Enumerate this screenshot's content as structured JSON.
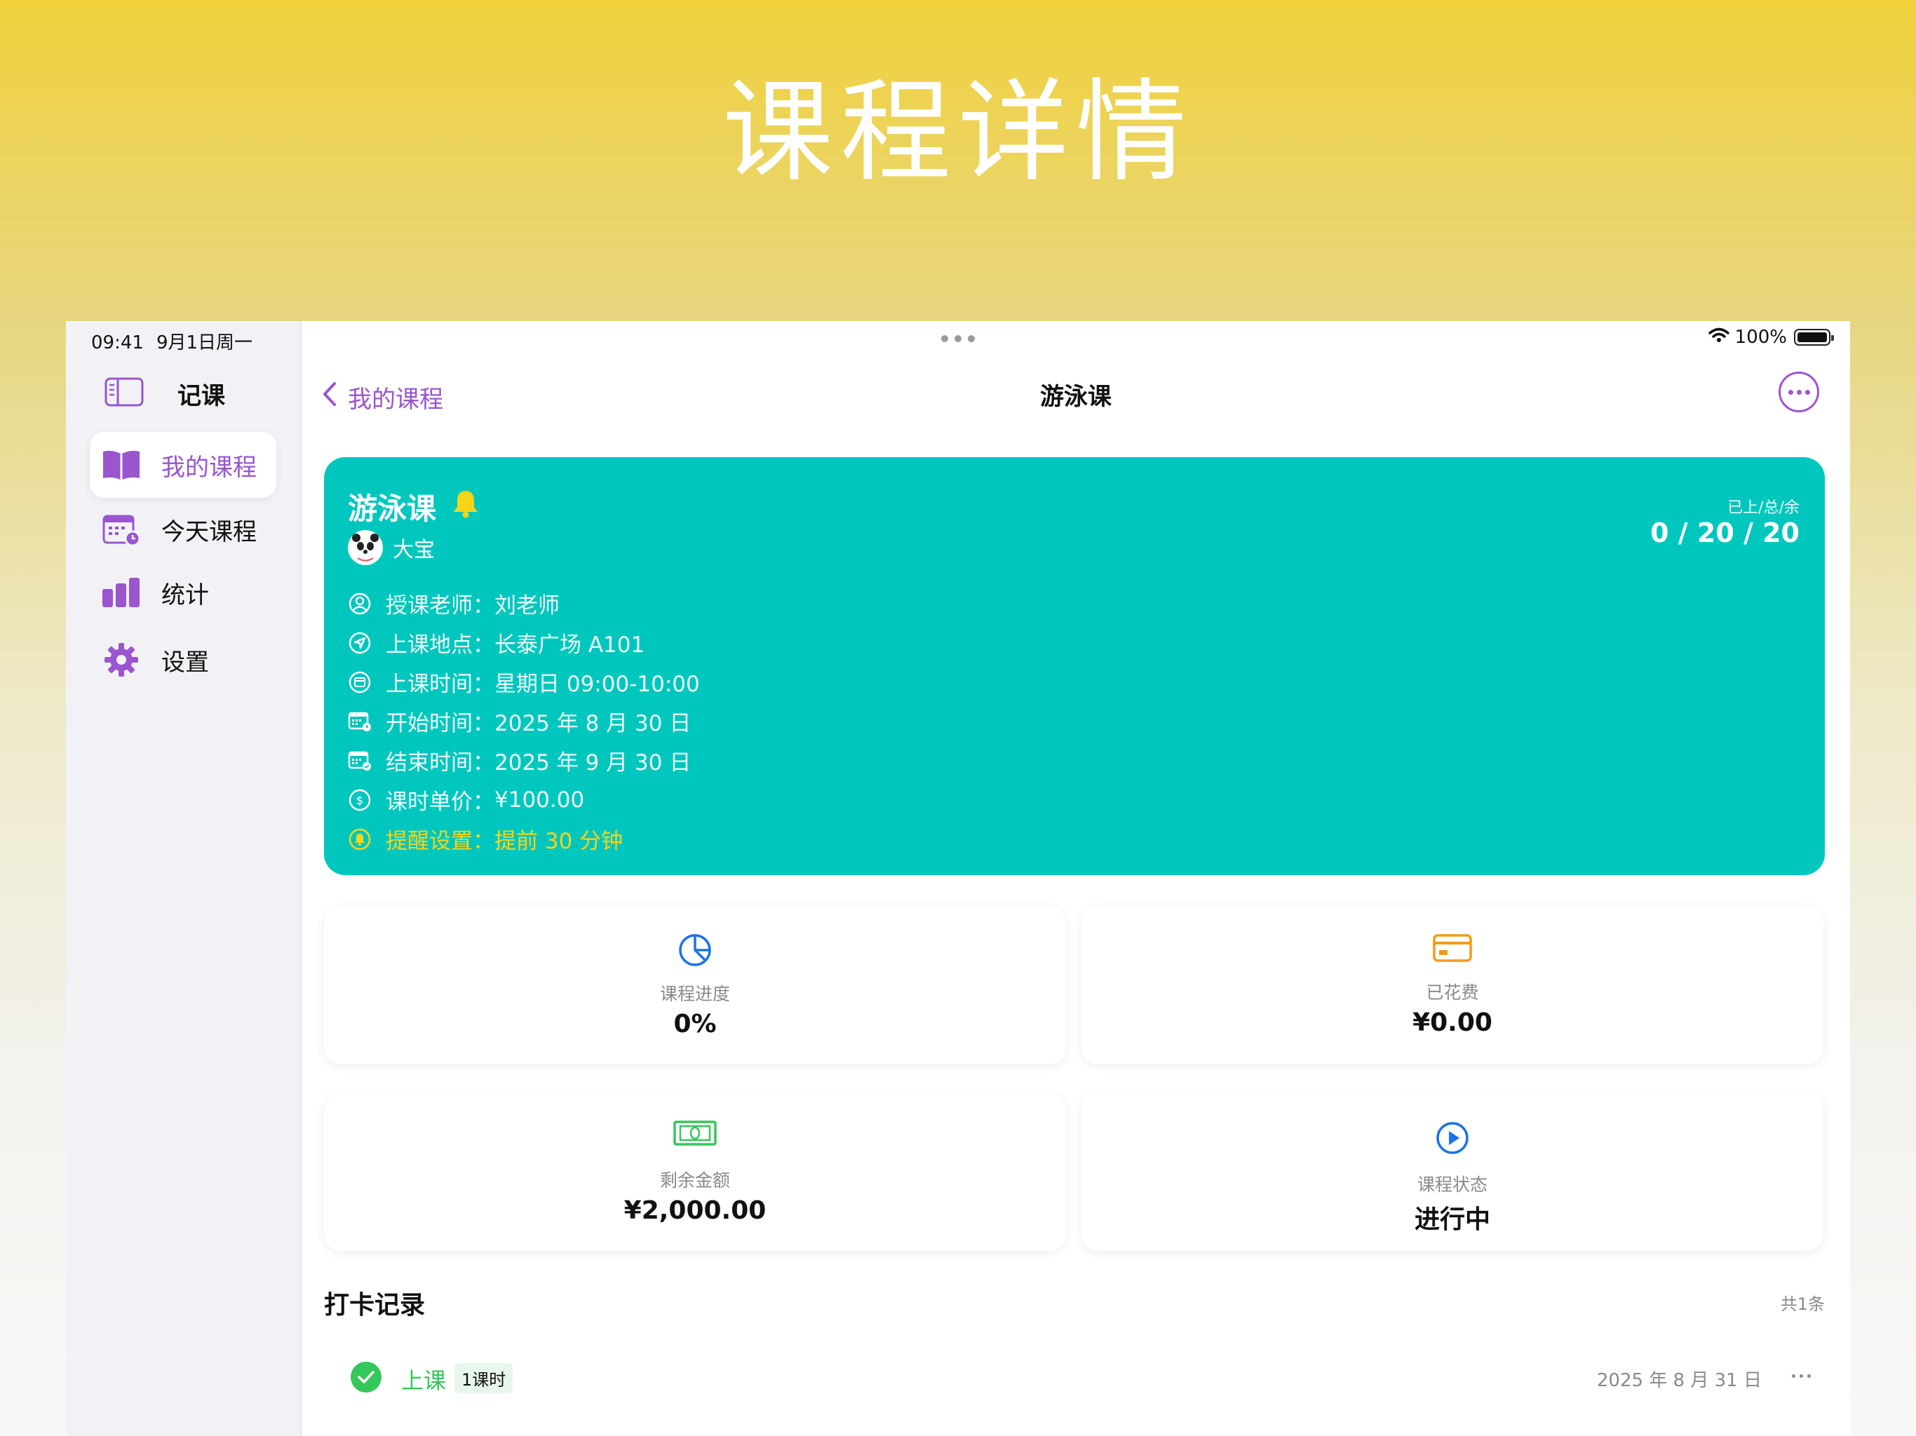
{
  "hero_title": "课程详情",
  "status": {
    "time": "09:41",
    "date": "9月1日周一",
    "battery": "100%"
  },
  "sidebar": {
    "app_name": "记课",
    "items": [
      {
        "label": "我的课程",
        "icon": "book-icon",
        "active": true
      },
      {
        "label": "今天课程",
        "icon": "calendar-clock-icon",
        "active": false
      },
      {
        "label": "统计",
        "icon": "bar-chart-icon",
        "active": false
      },
      {
        "label": "设置",
        "icon": "gear-icon",
        "active": false
      }
    ]
  },
  "nav": {
    "back_label": "我的课程",
    "title": "游泳课"
  },
  "course": {
    "name": "游泳课",
    "student": "大宝",
    "count_label": "已上/总/余",
    "count_value": "0 / 20 / 20",
    "rows": [
      {
        "label": "授课老师：",
        "value": "刘老师",
        "icon": "person-circle-icon"
      },
      {
        "label": "上课地点：",
        "value": "长泰广场 A101",
        "icon": "location-icon"
      },
      {
        "label": "上课时间：",
        "value": "星期日 09:00-10:00",
        "icon": "calendar-circle-icon"
      },
      {
        "label": "开始时间：",
        "value": "2025 年 8 月 30 日",
        "icon": "calendar-start-icon"
      },
      {
        "label": "结束时间：",
        "value": "2025 年 9 月 30 日",
        "icon": "calendar-end-icon"
      },
      {
        "label": "课时单价：",
        "value": "¥100.00",
        "icon": "dollar-circle-icon"
      },
      {
        "label": "提醒设置：",
        "value": "提前 30 分钟",
        "icon": "bell-circle-icon"
      }
    ]
  },
  "stats": [
    {
      "label": "课程进度",
      "value": "0%",
      "icon": "pie-chart-icon",
      "color": "#1a73e8"
    },
    {
      "label": "已花费",
      "value": "¥0.00",
      "icon": "credit-card-icon",
      "color": "#f39a1c"
    },
    {
      "label": "剩余金额",
      "value": "¥2,000.00",
      "icon": "banknote-icon",
      "color": "#34c759"
    },
    {
      "label": "课程状态",
      "value": "进行中",
      "icon": "play-circle-icon",
      "color": "#1a73e8"
    }
  ],
  "records": {
    "title": "打卡记录",
    "count": "共1条",
    "items": [
      {
        "type": "上课",
        "tag": "1课时",
        "date": "2025 年 8 月 31 日"
      }
    ]
  },
  "colors": {
    "accent": "#9a55cf",
    "card": "#00c7be",
    "warn": "#f6d417",
    "success": "#34c759"
  }
}
